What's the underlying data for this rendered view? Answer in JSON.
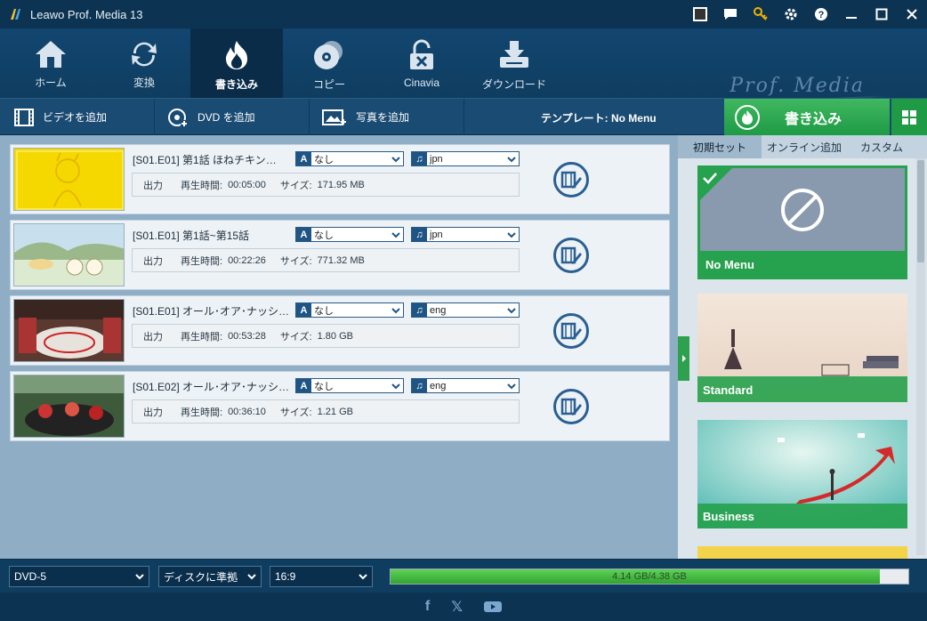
{
  "app": {
    "title": "Leawo Prof. Media 13",
    "brand": "Prof. Media"
  },
  "main_tabs": [
    {
      "label": "ホーム",
      "icon": "home-icon"
    },
    {
      "label": "変換",
      "icon": "convert-icon"
    },
    {
      "label": "書き込み",
      "icon": "burn-icon",
      "active": true
    },
    {
      "label": "コピー",
      "icon": "copy-icon"
    },
    {
      "label": "Cinavia",
      "icon": "cinavia-icon"
    },
    {
      "label": "ダウンロード",
      "icon": "download-icon"
    }
  ],
  "toolbar": {
    "add_video": "ビデオを追加",
    "add_dvd": "DVD を追加",
    "add_photo": "写真を追加",
    "template_label": "テンプレート: No Menu",
    "burn": "書き込み"
  },
  "rows": [
    {
      "title": "[S01.E01] 第1話 ほねチキン…",
      "subtitle": "なし",
      "audio": "jpn",
      "out": "出力",
      "dur_label": "再生時間:",
      "duration": "00:05:00",
      "size_label": "サイズ:",
      "size": "171.95 MB"
    },
    {
      "title": "[S01.E01] 第1話~第15話",
      "subtitle": "なし",
      "audio": "jpn",
      "out": "出力",
      "dur_label": "再生時間:",
      "duration": "00:22:26",
      "size_label": "サイズ:",
      "size": "771.32 MB"
    },
    {
      "title": "[S01.E01] オール･オア･ナッシ…",
      "subtitle": "なし",
      "audio": "eng",
      "out": "出力",
      "dur_label": "再生時間:",
      "duration": "00:53:28",
      "size_label": "サイズ:",
      "size": "1.80 GB"
    },
    {
      "title": "[S01.E02] オール･オア･ナッシ…",
      "subtitle": "なし",
      "audio": "eng",
      "out": "出力",
      "dur_label": "再生時間:",
      "duration": "00:36:10",
      "size_label": "サイズ:",
      "size": "1.21 GB"
    }
  ],
  "side_tabs": [
    "初期セット",
    "オンライン追加",
    "カスタム"
  ],
  "templates": [
    {
      "name": "No Menu",
      "selected": true
    },
    {
      "name": "Standard"
    },
    {
      "name": "Business"
    }
  ],
  "bottom": {
    "disc_type": "DVD-5",
    "quality": "ディスクに準拠",
    "aspect": "16:9",
    "progress_text": "4.14 GB/4.38 GB",
    "progress_fraction": 0.945
  },
  "colors": {
    "accent_green": "#2ea14f",
    "dark_blue": "#0f3d60"
  }
}
